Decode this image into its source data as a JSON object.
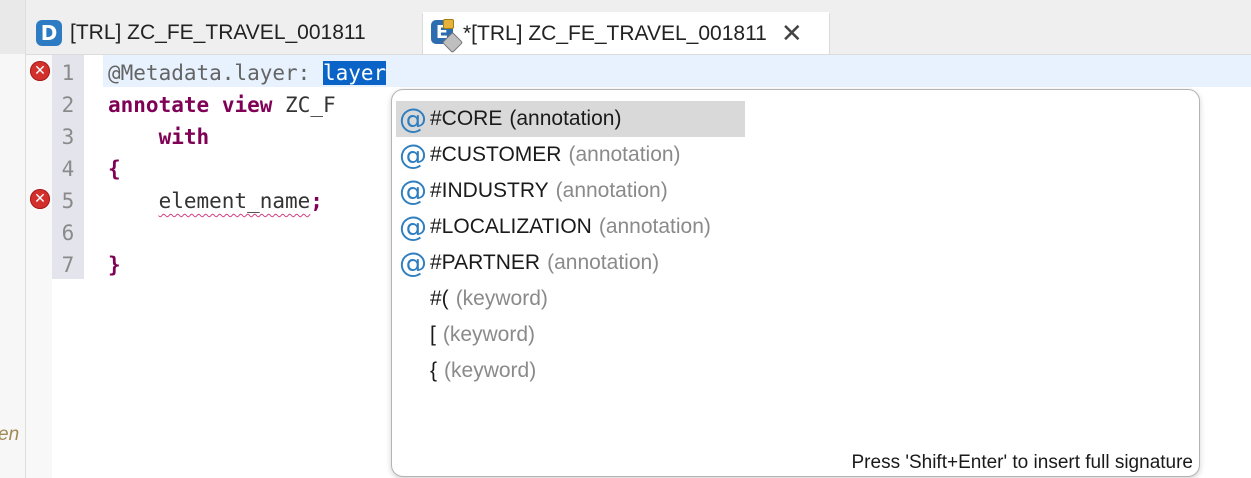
{
  "left_panel": {
    "text_fragment": "en"
  },
  "tabs": [
    {
      "label": "[TRL] ZC_FE_TRAVEL_001811",
      "icon": "ddl-source-icon",
      "icon_letter": "D"
    },
    {
      "label": "*[TRL] ZC_FE_TRAVEL_001811",
      "icon": "metadata-extension-icon",
      "icon_letter": "E",
      "close_glyph": "✕"
    }
  ],
  "editor": {
    "line_numbers": [
      "1",
      "2",
      "3",
      "4",
      "5",
      "6",
      "7"
    ],
    "lines": {
      "l1_prefix": "@Metadata.layer: ",
      "l1_selected": "layer",
      "l2_kw1": "annotate",
      "l2_kw2": "view",
      "l2_rest": "ZC_F",
      "l3_kw": "with",
      "l4": "{",
      "l5_name": "element_name",
      "l5_semicolon": ";",
      "l7": "}"
    },
    "error_markers_on_lines": [
      "1",
      "5"
    ],
    "error_glyph": "✕"
  },
  "completion_popup": {
    "proposals": [
      {
        "label": "#CORE",
        "qualifier": "(annotation)",
        "icon": "annotation-icon",
        "selected": true
      },
      {
        "label": "#CUSTOMER",
        "qualifier": "(annotation)",
        "icon": "annotation-icon",
        "selected": false
      },
      {
        "label": "#INDUSTRY",
        "qualifier": "(annotation)",
        "icon": "annotation-icon",
        "selected": false
      },
      {
        "label": "#LOCALIZATION",
        "qualifier": "(annotation)",
        "icon": "annotation-icon",
        "selected": false
      },
      {
        "label": "#PARTNER",
        "qualifier": "(annotation)",
        "icon": "annotation-icon",
        "selected": false
      },
      {
        "label": "#(",
        "qualifier": "(keyword)",
        "icon": "none",
        "selected": false
      },
      {
        "label": "[",
        "qualifier": "(keyword)",
        "icon": "none",
        "selected": false
      },
      {
        "label": "{",
        "qualifier": "(keyword)",
        "icon": "none",
        "selected": false
      }
    ],
    "annotation_glyph": "@",
    "status_text": "Press 'Shift+Enter' to insert full signature"
  },
  "colors": {
    "keyword": "#7f0055",
    "selection": "#0a64c8",
    "current_line": "#e8f2fe",
    "error": "#d2302d",
    "annotation_icon": "#2f7fc0"
  }
}
